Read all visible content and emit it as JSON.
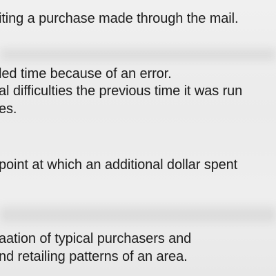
{
  "document": {
    "lines": [
      "iting a purchase made through the mail.",
      "led time because of an error.",
      "al difficulties the previous time it was run",
      "es.",
      "point at which an additional dollar spent",
      "aation of typical purchasers and",
      "nd retailing patterns of an area."
    ]
  }
}
